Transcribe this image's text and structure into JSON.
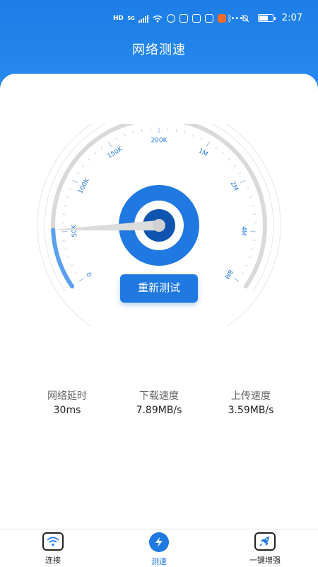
{
  "status_bar": {
    "network_type": "5G",
    "hd_label": "HD",
    "time": "2:07"
  },
  "header": {
    "title": "网络测速"
  },
  "gauge": {
    "tick_labels": [
      "0",
      "50K",
      "100K",
      "150K",
      "200K",
      "1M",
      "2M",
      "4M",
      "8M"
    ],
    "progress_fraction": 0.13,
    "accent_color": "#1f79e0",
    "progress_color": "#5ba0ee"
  },
  "actions": {
    "retest_label": "重新测试"
  },
  "stats": [
    {
      "label": "网络延时",
      "value": "30ms"
    },
    {
      "label": "下载速度",
      "value": "7.89MB/s"
    },
    {
      "label": "上传速度",
      "value": "3.59MB/s"
    }
  ],
  "bottom_nav": [
    {
      "label": "连接",
      "icon": "wifi-icon",
      "active": false
    },
    {
      "label": "测速",
      "icon": "lightning-icon",
      "active": true
    },
    {
      "label": "一键增强",
      "icon": "rocket-icon",
      "active": false
    }
  ],
  "colors": {
    "brand": "#1f79e0",
    "header": "#2b8cf2"
  }
}
